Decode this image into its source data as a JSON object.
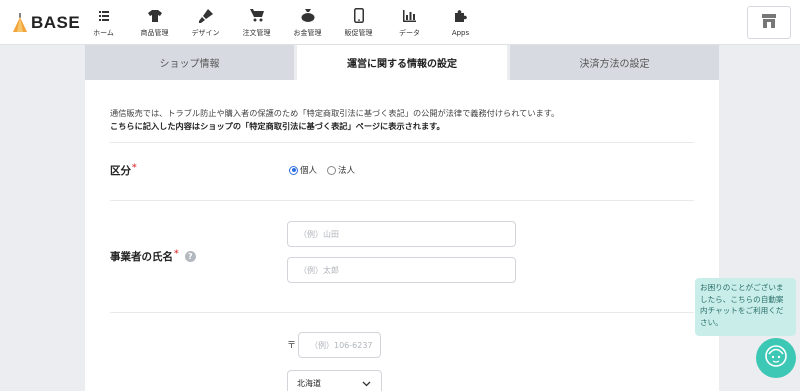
{
  "header": {
    "logo_text": "BASE",
    "nav": [
      {
        "icon": "home-icon",
        "label": "ホーム"
      },
      {
        "icon": "shirt-icon",
        "label": "商品管理"
      },
      {
        "icon": "brush-icon",
        "label": "デザイン"
      },
      {
        "icon": "cart-icon",
        "label": "注文管理"
      },
      {
        "icon": "money-bag-icon",
        "label": "お金管理"
      },
      {
        "icon": "phone-icon",
        "label": "販促管理"
      },
      {
        "icon": "bar-chart-icon",
        "label": "データ"
      },
      {
        "icon": "puzzle-icon",
        "label": "Apps"
      }
    ],
    "shop_icon": "shop-icon"
  },
  "tabs": [
    {
      "label": "ショップ情報",
      "active": false
    },
    {
      "label": "運営に関する情報の設定",
      "active": true
    },
    {
      "label": "決済方法の設定",
      "active": false
    }
  ],
  "notice": {
    "line1": "通信販売では、トラブル防止や購入者の保護のため「特定商取引法に基づく表記」の公開が法律で義務付けられています。",
    "line2": "こちらに記入した内容はショップの「特定商取引法に基づく表記」ページに表示されます。"
  },
  "form": {
    "category": {
      "label": "区分",
      "required_mark": "*",
      "options": [
        {
          "label": "個人",
          "checked": true
        },
        {
          "label": "法人",
          "checked": false
        }
      ]
    },
    "business_name": {
      "label": "事業者の氏名",
      "required_mark": "*",
      "help_icon": "?",
      "last_name_placeholder": "（例）山田",
      "first_name_placeholder": "（例）太郎"
    },
    "address": {
      "postal_mark": "〒",
      "postal_placeholder": "（例）106-6237",
      "prefecture_value": "北海道"
    }
  },
  "chat": {
    "message": "お困りのことがございましたら、こちらの自動案内チャットをご利用ください。"
  },
  "colors": {
    "accent": "#2f6fe0",
    "required": "#e0484c",
    "chat": "#3cc8b4",
    "chat_bubble": "#c9eee9",
    "tab_inactive": "#d7dbe1",
    "background": "#ebedf0"
  }
}
